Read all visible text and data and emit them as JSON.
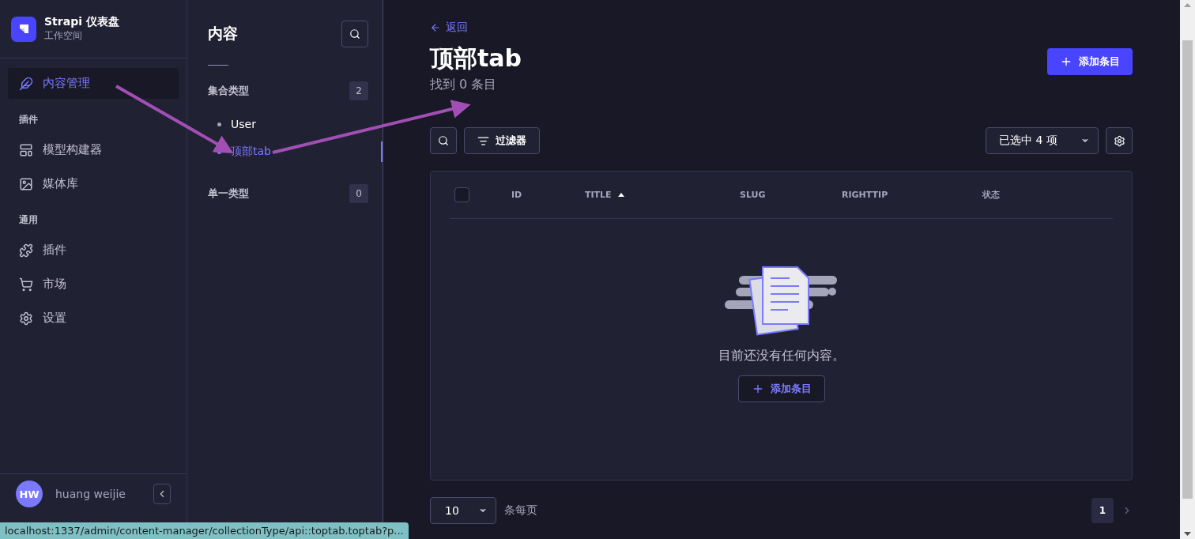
{
  "brand": {
    "title": "Strapi 仪表盘",
    "subtitle": "工作空间"
  },
  "nav": [
    {
      "items": [
        {
          "label": "内容管理",
          "selected": true
        }
      ]
    },
    {
      "heading": "插件",
      "items": [
        {
          "label": "模型构建器",
          "selected": false
        },
        {
          "label": "媒体库",
          "selected": false
        }
      ]
    },
    {
      "heading": "通用",
      "items": [
        {
          "label": "插件",
          "selected": false
        },
        {
          "label": "市场",
          "selected": false
        },
        {
          "label": "设置",
          "selected": false
        }
      ]
    }
  ],
  "user": {
    "initials": "HW",
    "name": "huang weijie"
  },
  "content_panel": {
    "title": "内容",
    "groups": [
      {
        "label": "集合类型",
        "count": "2",
        "items": [
          {
            "label": "User",
            "selected": false
          },
          {
            "label": "顶部tab",
            "selected": true
          }
        ]
      },
      {
        "label": "单一类型",
        "count": "0"
      }
    ]
  },
  "main": {
    "back": "返回",
    "title": "顶部tab",
    "subtitle": "找到 0 条目",
    "add_button": "添加条目",
    "filter_button": "过滤器",
    "columns_select": "已选中 4 项",
    "table": {
      "select_all": {
        "checked": false
      },
      "columns": [
        {
          "label": "ID",
          "sorted": false
        },
        {
          "label": "TITLE",
          "sorted": true
        },
        {
          "label": "SLUG",
          "sorted": false
        },
        {
          "label": "RIGHTTIP",
          "sorted": false
        },
        {
          "label": "状态",
          "sorted": false
        }
      ]
    },
    "empty": {
      "message": "目前还没有任何内容。",
      "button": "添加条目"
    },
    "per_page": {
      "value": "10",
      "label": "条每页"
    },
    "pagination": [
      {
        "label": "1",
        "selected": true
      }
    ]
  },
  "status_url": "localhost:1337/admin/content-manager/collectionType/api::toptab.toptab?p..."
}
